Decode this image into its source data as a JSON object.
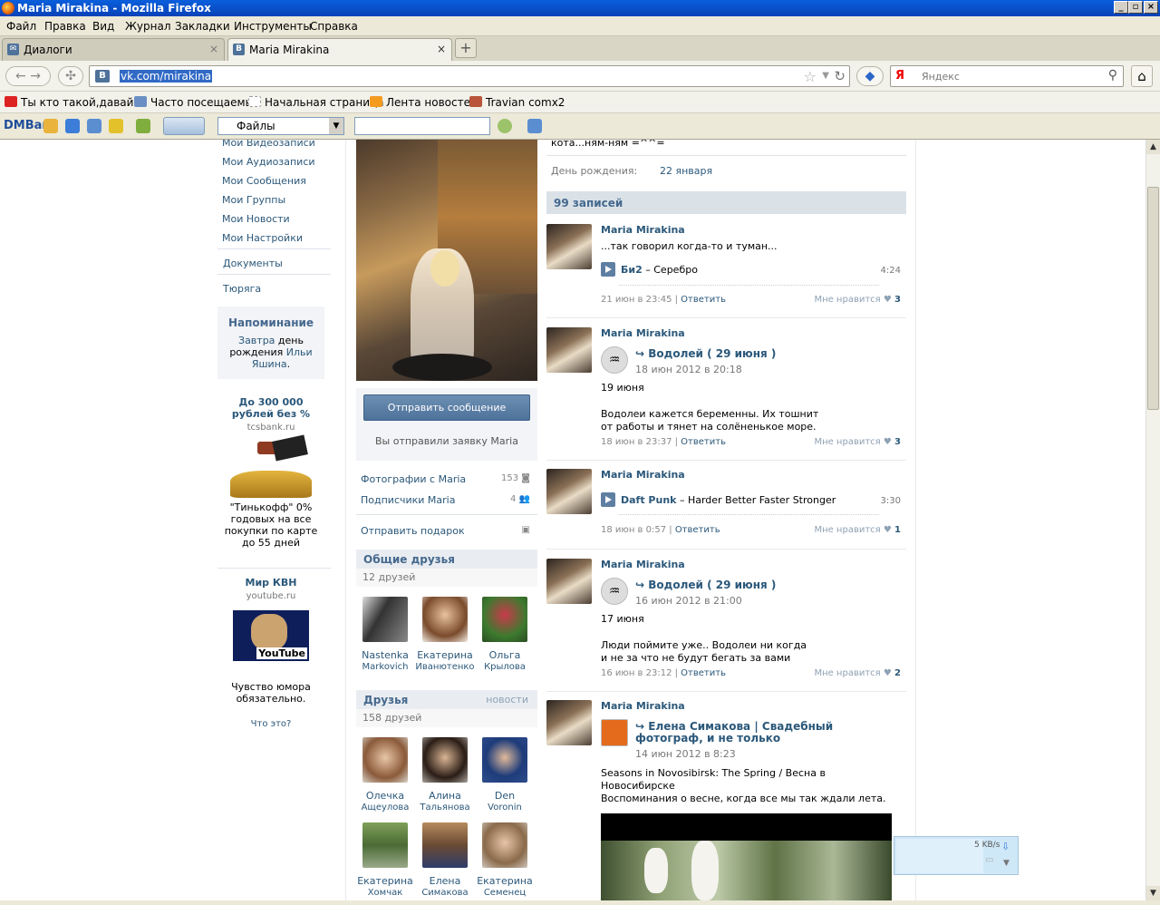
{
  "window": {
    "title": "Maria Mirakina - Mozilla Firefox"
  },
  "menu": [
    "Файл",
    "Правка",
    "Вид",
    "Журнал",
    "Закладки",
    "Инструменты",
    "Справка"
  ],
  "tabs": [
    {
      "label": "Диалоги"
    },
    {
      "label": "Maria Mirakina"
    }
  ],
  "nav": {
    "url": "vk.com/mirakina",
    "search_placeholder": "Яндекс",
    "search_engine": "Я"
  },
  "bookmarks": [
    "Ты кто такой,давай...",
    "Часто посещаемые",
    "Начальная страница",
    "Лента новостей",
    "Travian comx2"
  ],
  "dmbar": {
    "logo": "DMBar",
    "files": "Файлы"
  },
  "leftmenu": [
    "Мои Видеозаписи",
    "Мои Аудиозаписи",
    "Мои Сообщения",
    "Мои Группы",
    "Мои Новости",
    "Мои Настройки",
    "Документы",
    "Тюряга"
  ],
  "reminder": {
    "title": "Напоминание",
    "pre": "Завтра",
    "mid": " день рождения ",
    "name": "Ильи Яшина",
    "post": "."
  },
  "ads": [
    {
      "title": "До 300 000 рублей без %",
      "domain": "tcsbank.ru",
      "text": "\"Тинькофф\" 0% годовых на все покупки по карте до 55 дней"
    },
    {
      "title": "Мир КВН",
      "domain": "youtube.ru",
      "text": "Чувство юмора обязательно.",
      "logo": "YouTube"
    }
  ],
  "ads_more": "Что это?",
  "profile": {
    "send_message": "Отправить сообщение",
    "request_sent": "Вы отправили заявку Maria",
    "photos_link": "Фотографии с Maria",
    "photos_count": "153",
    "followers_link": "Подписчики Maria",
    "followers_count": "4",
    "gift_link": "Отправить подарок",
    "common_friends": {
      "title": "Общие друзья",
      "count": "12 друзей",
      "items": [
        {
          "n1": "Nastenka",
          "n2": "Markovich"
        },
        {
          "n1": "Екатерина",
          "n2": "Иванютенко"
        },
        {
          "n1": "Ольга",
          "n2": "Крылова"
        }
      ]
    },
    "friends": {
      "title": "Друзья",
      "news": "новости",
      "count": "158 друзей",
      "items": [
        {
          "n1": "Олечка",
          "n2": "Ащеулова"
        },
        {
          "n1": "Алина",
          "n2": "Тальянова"
        },
        {
          "n1": "Den",
          "n2": "Voronin"
        },
        {
          "n1": "Екатерина",
          "n2": "Хомчак"
        },
        {
          "n1": "Елена",
          "n2": "Симакова"
        },
        {
          "n1": "Екатерина",
          "n2": "Семенец"
        }
      ]
    }
  },
  "info": {
    "status_tail": "кота...ням-ням =^^=",
    "birthday_label": "День рождения:",
    "birthday_value": "22 января"
  },
  "wall": {
    "count": "99 записей",
    "posts": [
      {
        "author": "Maria Mirakina",
        "text": "...так говорил когда-то и туман...",
        "track_artist": "Би2",
        "track_title": " – Серебро",
        "duration": "4:24",
        "date": "21 июн в 23:45",
        "reply": "Ответить",
        "like": "Мне нравится",
        "likes": "3"
      },
      {
        "author": "Maria Mirakina",
        "repost_title": "Водолей ( 29 июня )",
        "repost_date": "18 июн 2012 в 20:18",
        "text1": "19 июня",
        "text2": "Водолеи кажется беременны. Их тошнит",
        "text3": "от работы и тянет на солёненькое море.",
        "date": "18 июн в 23:37",
        "reply": "Ответить",
        "like": "Мне нравится",
        "likes": "3"
      },
      {
        "author": "Maria Mirakina",
        "track_artist": "Daft Punk",
        "track_title": " – Harder Better Faster Stronger",
        "duration": "3:30",
        "date": "18 июн в 0:57",
        "reply": "Ответить",
        "like": "Мне нравится",
        "likes": "1"
      },
      {
        "author": "Maria Mirakina",
        "repost_title": "Водолей ( 29 июня )",
        "repost_date": "16 июн 2012 в 21:00",
        "text1": "17 июня",
        "text2": "Люди поймите уже.. Водолеи ни когда",
        "text3": "и не за что не будут бегать за вами",
        "date": "16 июн в 23:12",
        "reply": "Ответить",
        "like": "Мне нравится",
        "likes": "2"
      },
      {
        "author": "Maria Mirakina",
        "repost_title": "Елена Симакова | Свадебный фотограф, и не только",
        "repost_date": "14 июн 2012 в 8:23",
        "text1": "Seasons in Novosibirsk: The Spring / Весна в Новосибирске",
        "text2": "Воспоминания о весне, когда все мы так ждали лета."
      }
    ]
  },
  "download": {
    "speed": "5 KB/s"
  }
}
